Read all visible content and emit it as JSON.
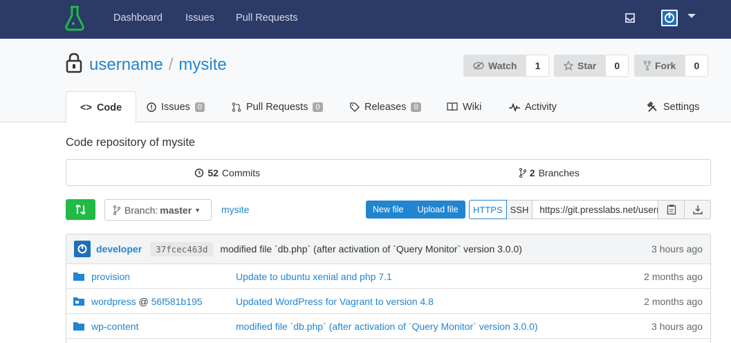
{
  "nav": {
    "items": [
      "Dashboard",
      "Issues",
      "Pull Requests"
    ]
  },
  "repo": {
    "owner": "username",
    "separator": "/",
    "name": "mysite",
    "description": "Code repository of mysite"
  },
  "actions": {
    "watch": {
      "label": "Watch",
      "count": "1"
    },
    "star": {
      "label": "Star",
      "count": "0"
    },
    "fork": {
      "label": "Fork",
      "count": "0"
    }
  },
  "tabs": [
    {
      "label": "Code"
    },
    {
      "label": "Issues",
      "badge": "0"
    },
    {
      "label": "Pull Requests",
      "badge": "0"
    },
    {
      "label": "Releases",
      "badge": "0"
    },
    {
      "label": "Wiki"
    },
    {
      "label": "Activity"
    },
    {
      "label": "Settings"
    }
  ],
  "stats": {
    "commits_count": "52",
    "commits_label": "Commits",
    "branches_count": "2",
    "branches_label": "Branches"
  },
  "toolbar": {
    "branch_prefix": "Branch:",
    "branch_name": "master",
    "breadcrumb": "mysite",
    "new_file": "New file",
    "upload_file": "Upload file",
    "https": "HTTPS",
    "ssh": "SSH",
    "clone_url": "https://git.presslabs.net/username/mysite.git"
  },
  "latest_commit": {
    "author": "developer",
    "sha": "37fcec463d",
    "message": "modified file `db.php` (after activation of `Query Monitor` version 3.0.0)",
    "time": "3 hours ago"
  },
  "files": [
    {
      "name": "provision",
      "submodule": "",
      "message": "Update to ubuntu xenial and php 7.1",
      "time": "2 months ago",
      "icon": "folder-icon"
    },
    {
      "name": "wordpress",
      "submodule_at": "@",
      "submodule": "56f581b195",
      "message": "Updated WordPress for Vagrant to version 4.8",
      "time": "2 months ago",
      "icon": "submodule-icon"
    },
    {
      "name": "wp-content",
      "submodule": "",
      "message": "modified file `db.php` (after activation of `Query Monitor` version 3.0.0)",
      "time": "3 hours ago",
      "icon": "folder-icon"
    }
  ],
  "colors": {
    "header_bg": "#2b3a67",
    "accent": "#2185d0",
    "success": "#21ba45",
    "logo": "#21ba45"
  }
}
